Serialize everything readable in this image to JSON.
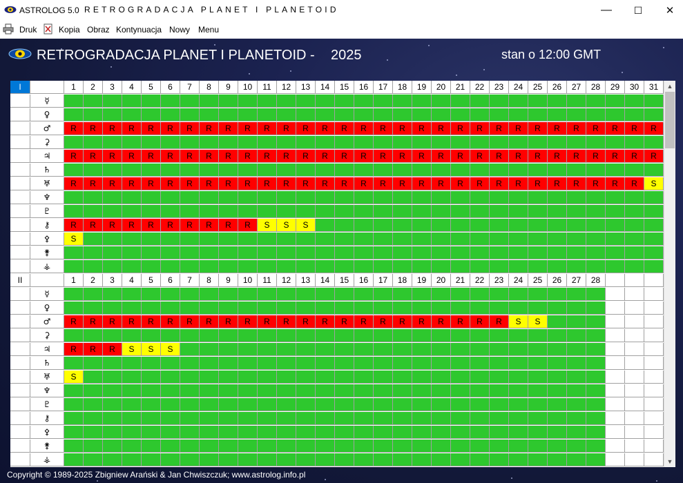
{
  "window": {
    "app_name": "ASTROLOG 5.0",
    "title": "RETROGRADACJA PLANET I PLANETOID",
    "minimize": "—",
    "maximize": "☐",
    "close": "✕"
  },
  "menu": [
    {
      "label": "Druk",
      "icon": "printer-icon"
    },
    {
      "label": "Kopia",
      "icon": "copy-document-icon"
    },
    {
      "label": "Obraz"
    },
    {
      "label": "Kontynuacja"
    },
    {
      "label": "Nowy"
    },
    {
      "label": "Menu"
    }
  ],
  "header": {
    "title": "RETROGRADACJA PLANET I PLANETOID -",
    "year": "2025",
    "status": "stan o 12:00 GMT"
  },
  "footer": "Copyright © 1989-2025 Zbigniew Arański  & Jan Chwiszczuk; www.astrolog.info.pl",
  "legend_colors": {
    "direct": "#2ec82e",
    "retrograde": "#ff0000",
    "stationary": "#ffff00"
  },
  "planet_symbols": [
    "☿",
    "♀",
    "♂",
    "⚳",
    "♃",
    "♄",
    "♅",
    "♆",
    "♇",
    "⚷",
    "⚴",
    "⚵",
    "⚶"
  ],
  "months": [
    {
      "label": "I",
      "days": 31,
      "rows": [
        {
          "symbol": "☿",
          "cells": ""
        },
        {
          "symbol": "♀",
          "cells": ""
        },
        {
          "symbol": "♂",
          "cells": "RRRRRRRRRRRRRRRRRRRRRRRRRRRRRRR"
        },
        {
          "symbol": "⚳",
          "cells": ""
        },
        {
          "symbol": "♃",
          "cells": "RRRRRRRRRRRRRRRRRRRRRRRRRRRRRRR"
        },
        {
          "symbol": "♄",
          "cells": ""
        },
        {
          "symbol": "♅",
          "cells": "RRRRRRRRRRRRRRRRRRRRRRRRRRRRRRS"
        },
        {
          "symbol": "♆",
          "cells": ""
        },
        {
          "symbol": "♇",
          "cells": ""
        },
        {
          "symbol": "⚷",
          "cells": "RRRRRRRRRRSSS"
        },
        {
          "symbol": "⚴",
          "cells": "S"
        },
        {
          "symbol": "⚵",
          "cells": ""
        },
        {
          "symbol": "⚶",
          "cells": ""
        }
      ]
    },
    {
      "label": "II",
      "days": 28,
      "rows": [
        {
          "symbol": "☿",
          "cells": ""
        },
        {
          "symbol": "♀",
          "cells": ""
        },
        {
          "symbol": "♂",
          "cells": "RRRRRRRRRRRRRRRRRRRRRRRSS"
        },
        {
          "symbol": "⚳",
          "cells": ""
        },
        {
          "symbol": "♃",
          "cells": "RRRSSS"
        },
        {
          "symbol": "♄",
          "cells": ""
        },
        {
          "symbol": "♅",
          "cells": "S"
        },
        {
          "symbol": "♆",
          "cells": ""
        },
        {
          "symbol": "♇",
          "cells": ""
        },
        {
          "symbol": "⚷",
          "cells": ""
        },
        {
          "symbol": "⚴",
          "cells": ""
        },
        {
          "symbol": "⚵",
          "cells": ""
        },
        {
          "symbol": "⚶",
          "cells": ""
        }
      ]
    }
  ],
  "scrollbar": {
    "up": "▲",
    "down": "▼"
  }
}
